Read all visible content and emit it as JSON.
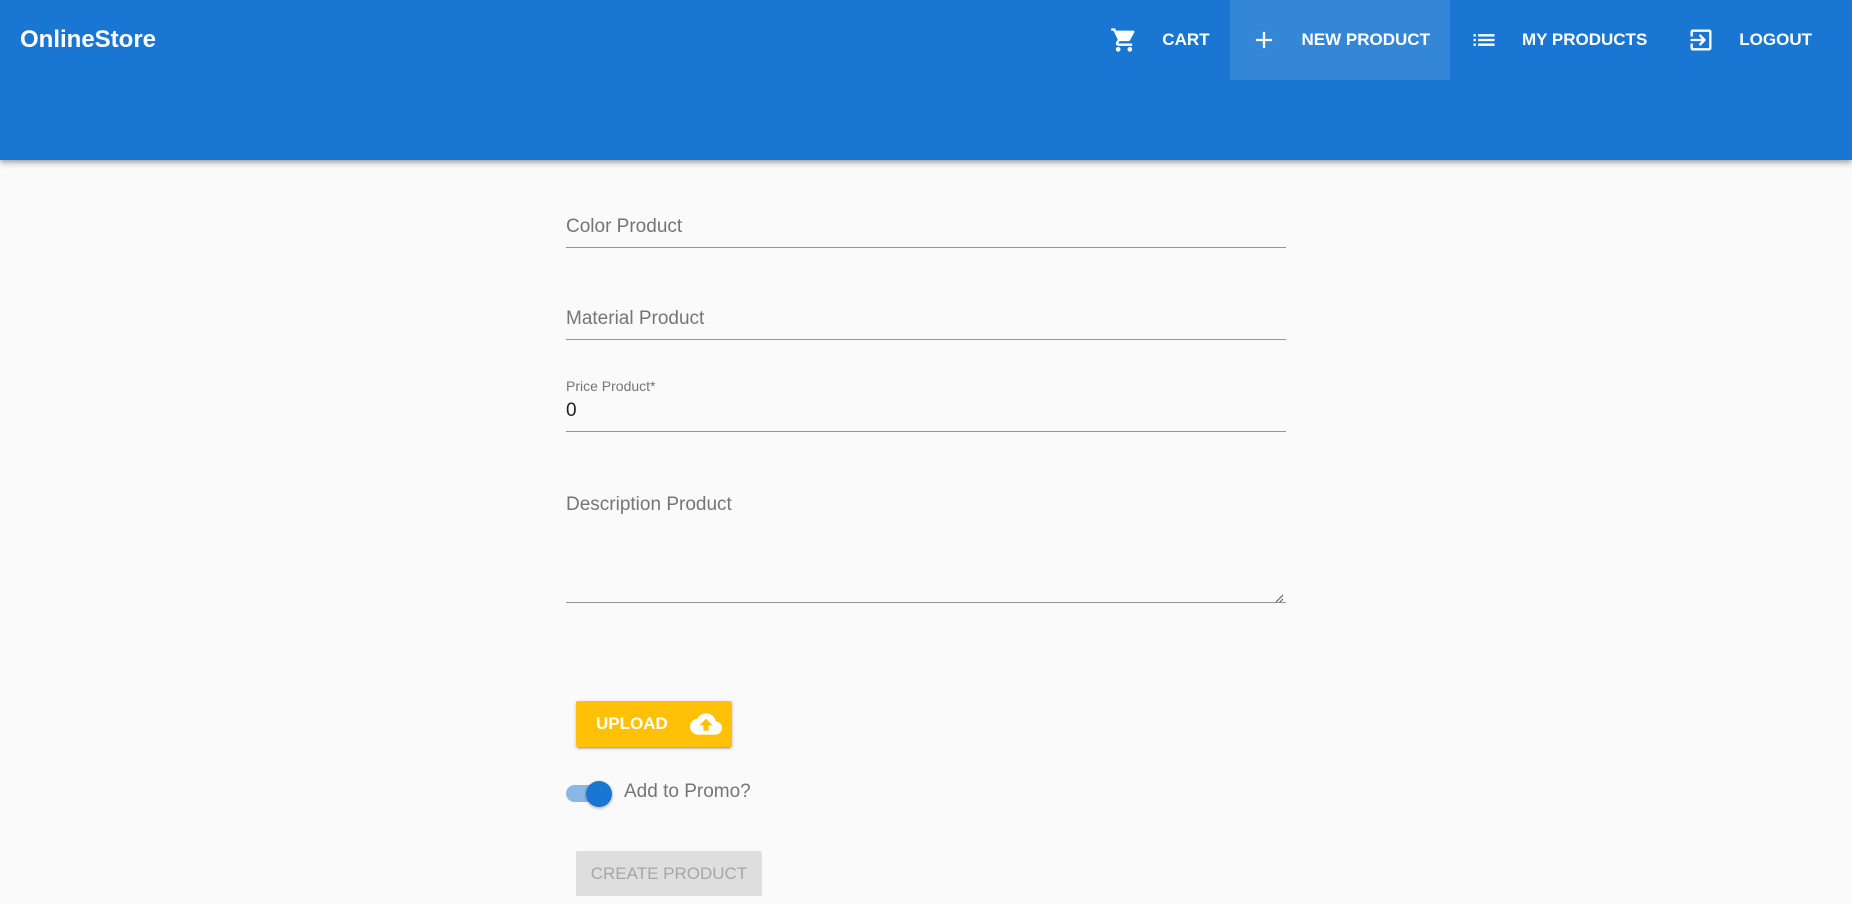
{
  "app": {
    "title": "OnlineStore",
    "accent_color": "#1976d2",
    "upload_color": "#ffc107"
  },
  "nav": {
    "items": [
      {
        "label": "CART",
        "icon": "cart-icon",
        "active": false
      },
      {
        "label": "NEW PRODUCT",
        "icon": "plus-icon",
        "active": true
      },
      {
        "label": "MY PRODUCTS",
        "icon": "list-icon",
        "active": false
      },
      {
        "label": "LOGOUT",
        "icon": "logout-icon",
        "active": false
      }
    ]
  },
  "form": {
    "color": {
      "placeholder": "Color Product",
      "value": ""
    },
    "material": {
      "placeholder": "Material Product",
      "value": ""
    },
    "price": {
      "label": "Price Product*",
      "value": "0"
    },
    "description": {
      "placeholder": "Description Product",
      "value": ""
    },
    "upload": {
      "label": "UPLOAD",
      "icon": "cloud-upload-icon"
    },
    "promo": {
      "label": "Add to Promo?",
      "checked": true
    },
    "submit": {
      "label": "CREATE PRODUCT",
      "disabled": true
    }
  }
}
